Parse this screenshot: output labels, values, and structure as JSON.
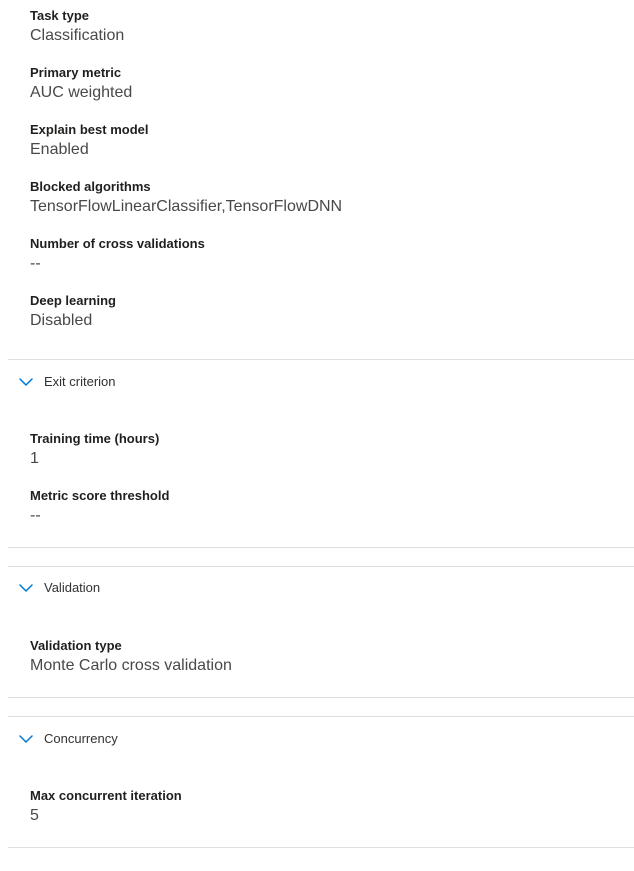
{
  "settings": {
    "task_type": {
      "label": "Task type",
      "value": "Classification"
    },
    "primary_metric": {
      "label": "Primary metric",
      "value": "AUC weighted"
    },
    "explain_best_model": {
      "label": "Explain best model",
      "value": "Enabled"
    },
    "blocked_algorithms": {
      "label": "Blocked algorithms",
      "value": "TensorFlowLinearClassifier,TensorFlowDNN"
    },
    "cross_validations": {
      "label": "Number of cross validations",
      "value": "--"
    },
    "deep_learning": {
      "label": "Deep learning",
      "value": "Disabled"
    }
  },
  "exit_criterion": {
    "title": "Exit criterion",
    "training_time": {
      "label": "Training time (hours)",
      "value": "1"
    },
    "metric_threshold": {
      "label": "Metric score threshold",
      "value": "--"
    }
  },
  "validation": {
    "title": "Validation",
    "validation_type": {
      "label": "Validation type",
      "value": "Monte Carlo cross validation"
    }
  },
  "concurrency": {
    "title": "Concurrency",
    "max_concurrent": {
      "label": "Max concurrent iteration",
      "value": "5"
    }
  },
  "icons": {
    "section_toggle": "chevron-down-icon"
  },
  "colors": {
    "accent": "#0078d4",
    "label": "#201f1e",
    "value": "#4a4847",
    "divider": "#e1dfdd"
  }
}
